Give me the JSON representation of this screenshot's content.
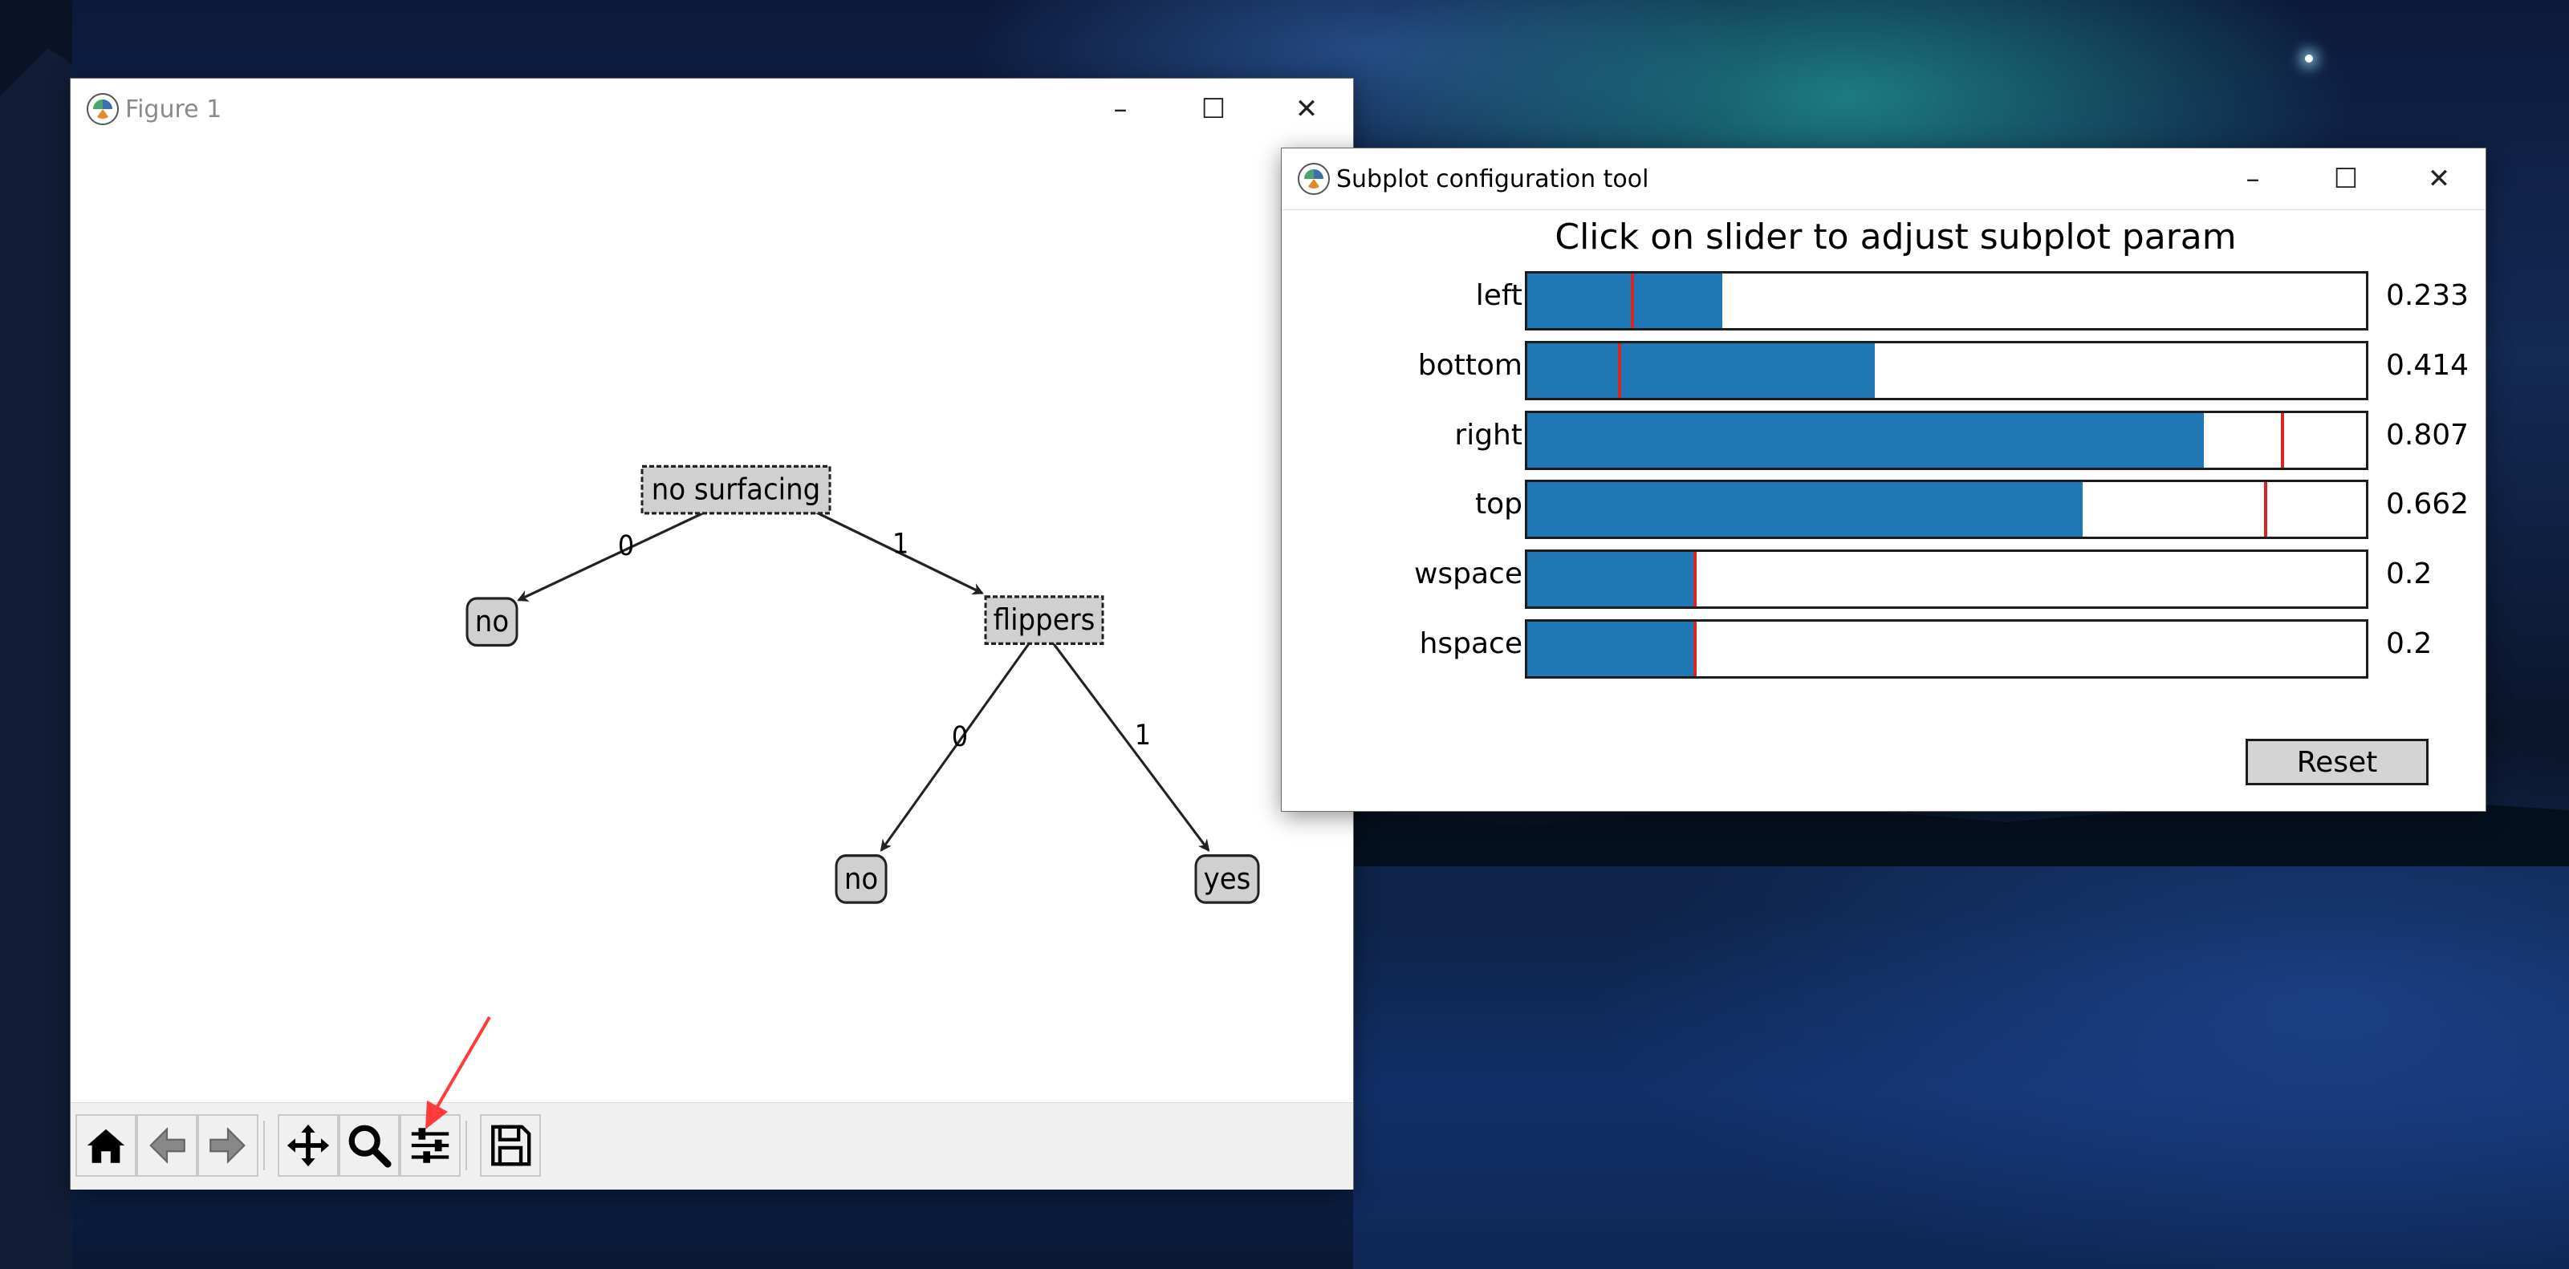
{
  "figure_window": {
    "title": "Figure 1",
    "tree": {
      "root_label": "no surfacing",
      "root_edge_left": "0",
      "root_edge_right": "1",
      "leaf_left": "no",
      "decision_node": "flippers",
      "node_edge_left": "0",
      "node_edge_right": "1",
      "leaf_bottom_left": "no",
      "leaf_bottom_right": "yes"
    },
    "toolbar": {
      "buttons": [
        "home-icon",
        "back-arrow-icon",
        "forward-arrow-icon",
        "pan-icon",
        "zoom-icon",
        "configure-subplots-icon",
        "save-icon"
      ]
    }
  },
  "config_window": {
    "title": "Subplot configuration tool",
    "heading": "Click on slider to adjust subplot param",
    "sliders": [
      {
        "label": "left",
        "value": "0.233",
        "fill": 0.233,
        "marker": 0.125
      },
      {
        "label": "bottom",
        "value": "0.414",
        "fill": 0.414,
        "marker": 0.11
      },
      {
        "label": "right",
        "value": "0.807",
        "fill": 0.807,
        "marker": 0.9
      },
      {
        "label": "top",
        "value": "0.662",
        "fill": 0.662,
        "marker": 0.88
      },
      {
        "label": "wspace",
        "value": "0.2",
        "fill": 0.2,
        "marker": 0.2
      },
      {
        "label": "hspace",
        "value": "0.2",
        "fill": 0.2,
        "marker": 0.2
      }
    ],
    "reset_label": "Reset"
  },
  "colors": {
    "slider_fill": "#1f77b4",
    "slider_marker": "#d62728",
    "annotation_arrow": "#ff3b3b"
  }
}
